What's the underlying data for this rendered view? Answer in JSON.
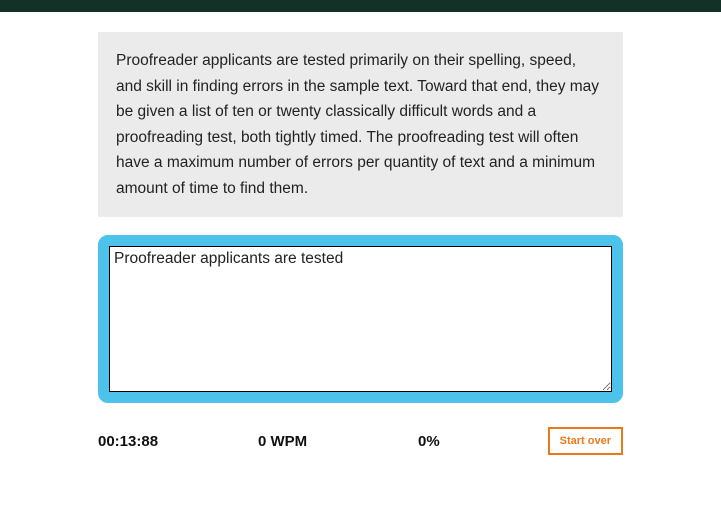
{
  "sample": {
    "text": "Proofreader applicants are tested primarily on their spelling, speed, and skill in finding errors in the sample text. Toward that end, they may be given a list of ten or twenty classically difficult words and a proofreading test, both tightly timed. The proofreading test will often have a maximum number of errors per quantity of text and a minimum amount of time to find them."
  },
  "input": {
    "value": "Proofreader applicants are tested"
  },
  "stats": {
    "timer": "00:13:88",
    "wpm": "0 WPM",
    "accuracy": "0%"
  },
  "buttons": {
    "start_over": "Start over"
  }
}
